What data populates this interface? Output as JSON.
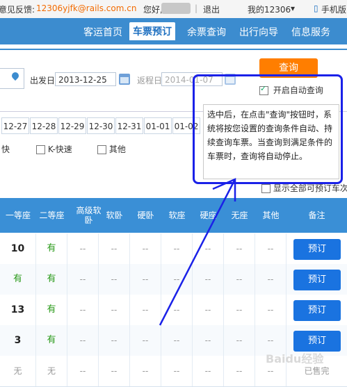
{
  "topbar": {
    "feedback": "意见反馈:",
    "email": "12306yjfk@rails.com.cn",
    "greeting": "您好,",
    "logout": "退出",
    "my12306": "我的12306",
    "mobile": "手机版"
  },
  "nav": {
    "items": [
      "客运首页",
      "车票预订",
      "余票查询",
      "出行向导",
      "信息服务"
    ],
    "active_index": 1
  },
  "search": {
    "depart_label": "出发日",
    "depart_value": "2013-12-25",
    "return_label": "返程日",
    "return_value": "2014-01-07",
    "query_button": "查询",
    "auto_query_label": "开启自动查询",
    "auto_query_checked": true
  },
  "dates": [
    "12-27",
    "12-28",
    "12-29",
    "12-30",
    "12-31",
    "01-01",
    "01-02"
  ],
  "filters": {
    "first_partial": "快",
    "k_label": "K-快速",
    "other_label": "其他",
    "show_all": "显示全部可预订车次"
  },
  "tooltip": {
    "text": "选中后，在点击\"查询\"按钮时，系统将按您设置的查询条件自动、持续查询车票。当查询到满足条件的车票时，查询将自动停止。"
  },
  "table": {
    "headers": [
      "一等座",
      "二等座",
      "高级软卧",
      "软卧",
      "硬卧",
      "软座",
      "硬座",
      "无座",
      "其他",
      "备注"
    ],
    "rows": [
      {
        "first": "10",
        "second": "有",
        "rest": [
          "--",
          "--",
          "--",
          "--",
          "--",
          "--",
          "--"
        ],
        "action": "预订"
      },
      {
        "first": "有",
        "second": "有",
        "rest": [
          "--",
          "--",
          "--",
          "--",
          "--",
          "--",
          "--"
        ],
        "action": "预订"
      },
      {
        "first": "13",
        "second": "有",
        "rest": [
          "--",
          "--",
          "--",
          "--",
          "--",
          "--",
          "--"
        ],
        "action": "预订"
      },
      {
        "first": "3",
        "second": "有",
        "rest": [
          "--",
          "--",
          "--",
          "--",
          "--",
          "--",
          "--"
        ],
        "action": "预订"
      },
      {
        "first": "无",
        "second": "无",
        "rest": [
          "--",
          "--",
          "--",
          "--",
          "--",
          "--",
          "--"
        ],
        "action": "已售完"
      }
    ]
  },
  "watermark": "Baidu经验",
  "colors": {
    "nav_bg": "#3c8ccf",
    "accent_orange": "#ff7e00",
    "book_btn": "#1a73e0",
    "annotation": "#1a21e8"
  }
}
